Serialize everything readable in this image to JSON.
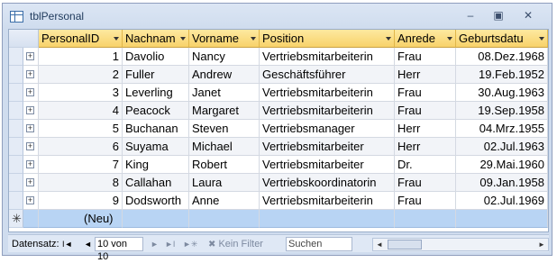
{
  "window": {
    "title": "tblPersonal",
    "btn_min": "–",
    "btn_max": "▣",
    "btn_close": "✕"
  },
  "columns": [
    "PersonalID",
    "Nachnam",
    "Vorname",
    "Position",
    "Anrede",
    "Geburtsdatu"
  ],
  "rows": [
    [
      "1",
      "Davolio",
      "Nancy",
      "Vertriebsmitarbeiterin",
      "Frau",
      "08.Dez.1968"
    ],
    [
      "2",
      "Fuller",
      "Andrew",
      "Geschäftsführer",
      "Herr",
      "19.Feb.1952"
    ],
    [
      "3",
      "Leverling",
      "Janet",
      "Vertriebsmitarbeiterin",
      "Frau",
      "30.Aug.1963"
    ],
    [
      "4",
      "Peacock",
      "Margaret",
      "Vertriebsmitarbeiterin",
      "Frau",
      "19.Sep.1958"
    ],
    [
      "5",
      "Buchanan",
      "Steven",
      "Vertriebsmanager",
      "Herr",
      "04.Mrz.1955"
    ],
    [
      "6",
      "Suyama",
      "Michael",
      "Vertriebsmitarbeiter",
      "Herr",
      "02.Jul.1963"
    ],
    [
      "7",
      "King",
      "Robert",
      "Vertriebsmitarbeiter",
      "Dr.",
      "29.Mai.1960"
    ],
    [
      "8",
      "Callahan",
      "Laura",
      "Vertriebskoordinatorin",
      "Frau",
      "09.Jan.1958"
    ],
    [
      "9",
      "Dodsworth",
      "Anne",
      "Vertriebsmitarbeiterin",
      "Frau",
      "02.Jul.1969"
    ]
  ],
  "new_row_label": "(Neu)",
  "expander_glyph": "+",
  "new_row_glyph": "✳",
  "statusbar": {
    "label": "Datensatz:",
    "first": "I◄",
    "prev": "◄",
    "record_value": "10 von 10",
    "next": "►",
    "last": "►I",
    "new": "►✳",
    "filter_label": "Kein Filter",
    "search_value": "Suchen",
    "scroll_left": "◄",
    "scroll_right": "►"
  }
}
